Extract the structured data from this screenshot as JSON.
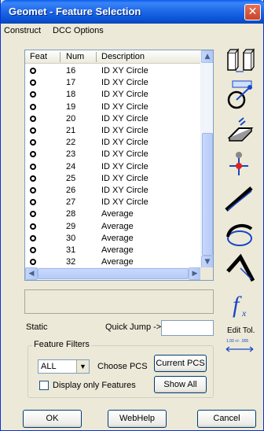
{
  "window": {
    "title": "Geomet - Feature Selection",
    "close_glyph": "✕"
  },
  "menu": [
    "Construct",
    "DCC Options"
  ],
  "list": {
    "columns": [
      "Feat",
      "Num",
      "Description"
    ],
    "rows": [
      {
        "num": "16",
        "description": "ID XY Circle"
      },
      {
        "num": "17",
        "description": "ID XY Circle"
      },
      {
        "num": "18",
        "description": "ID XY Circle"
      },
      {
        "num": "19",
        "description": "ID XY Circle"
      },
      {
        "num": "20",
        "description": "ID XY Circle"
      },
      {
        "num": "21",
        "description": "ID XY Circle"
      },
      {
        "num": "22",
        "description": "ID XY Circle"
      },
      {
        "num": "23",
        "description": "ID XY Circle"
      },
      {
        "num": "24",
        "description": "ID XY Circle"
      },
      {
        "num": "25",
        "description": "ID XY Circle"
      },
      {
        "num": "26",
        "description": "ID XY Circle"
      },
      {
        "num": "27",
        "description": "ID XY Circle"
      },
      {
        "num": "28",
        "description": "Average"
      },
      {
        "num": "29",
        "description": "Average"
      },
      {
        "num": "30",
        "description": "Average"
      },
      {
        "num": "31",
        "description": "Average"
      },
      {
        "num": "32",
        "description": "Average"
      }
    ],
    "scroll_up": "▲",
    "scroll_down": "▼",
    "scroll_left": "◀",
    "scroll_right": "▶"
  },
  "static_label": "Static",
  "quick_jump": {
    "label": "Quick Jump ->",
    "value": ""
  },
  "filters": {
    "title": "Feature Filters",
    "combo_value": "ALL",
    "combo_arrow": "▼",
    "choose_pcs_label": "Choose PCS",
    "current_pcs_button": "Current PCS",
    "display_only_label": "Display only Features",
    "show_all_button": "Show All"
  },
  "buttons": {
    "ok": "OK",
    "webhelp": "WebHelp",
    "cancel": "Cancel"
  },
  "toolbar": {
    "icons": [
      "distance-icon",
      "circle-probe-icon",
      "plane-icon",
      "point-icon",
      "line-icon",
      "circle-icon",
      "angle-icon",
      "formula-icon",
      "edit-tolerance-icon"
    ],
    "formula_glyph": "f",
    "formula_sub": "x",
    "edit_tol_label": "Edit Tol.",
    "edit_tol_small": "1.00 +/- .005"
  },
  "colors": {
    "accent": "#0a5ff0",
    "tool_blue": "#1747c8"
  }
}
